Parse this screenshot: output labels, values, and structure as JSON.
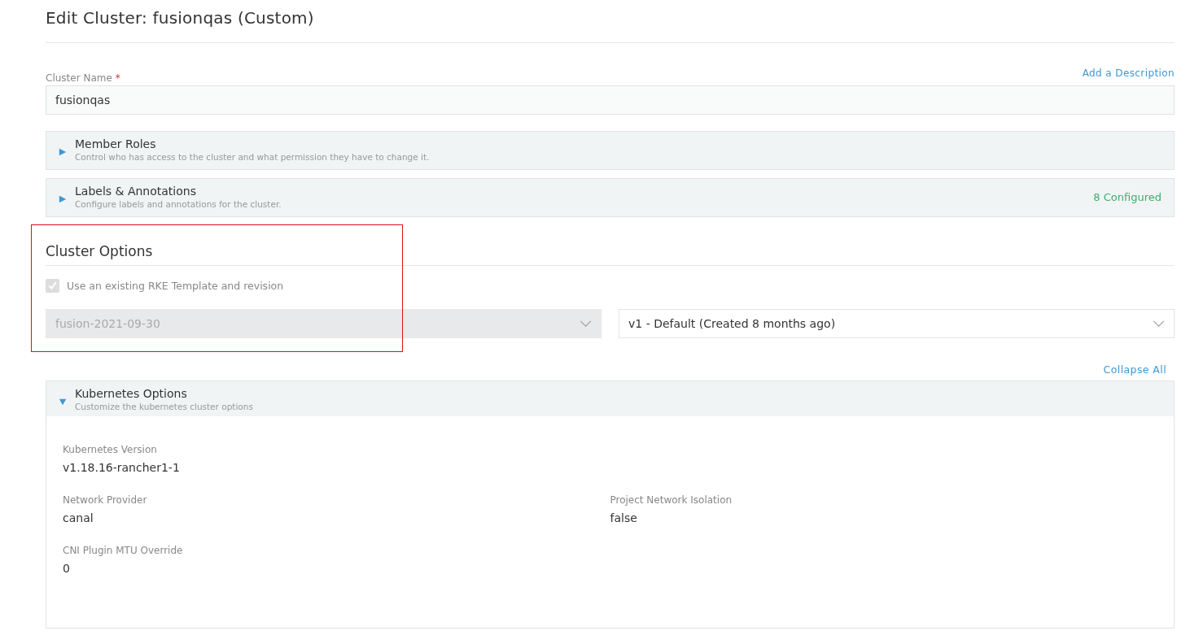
{
  "page_title": "Edit Cluster: fusionqas (Custom)",
  "cluster_name": {
    "label": "Cluster Name",
    "required_mark": "*",
    "value": "fusionqas",
    "add_description": "Add a Description"
  },
  "panels": [
    {
      "title": "Member Roles",
      "subtitle": "Control who has access to the cluster and what permission they have to change it.",
      "expanded": false
    },
    {
      "title": "Labels & Annotations",
      "subtitle": "Configure labels and annotations for the cluster.",
      "expanded": false,
      "status": "8 Configured"
    }
  ],
  "cluster_options": {
    "title": "Cluster Options",
    "highlighted": true,
    "template_checkbox": {
      "label": "Use an existing RKE Template and revision",
      "checked": true,
      "disabled": true
    },
    "selects": [
      {
        "value": "fusion-2021-09-30",
        "disabled": true
      },
      {
        "value": "v1 - Default (Created 8 months ago)",
        "disabled": false
      }
    ]
  },
  "collapse_all": "Collapse All",
  "kubernetes_options": {
    "title": "Kubernetes Options",
    "subtitle": "Customize the kubernetes cluster options",
    "expanded": true,
    "fields": [
      [
        {
          "label": "Kubernetes Version",
          "value": "v1.18.16-rancher1-1"
        }
      ],
      [
        {
          "label": "Network Provider",
          "value": "canal"
        },
        {
          "label": "Project Network Isolation",
          "value": "false"
        }
      ],
      [
        {
          "label": "CNI Plugin MTU Override",
          "value": "0"
        }
      ]
    ]
  }
}
